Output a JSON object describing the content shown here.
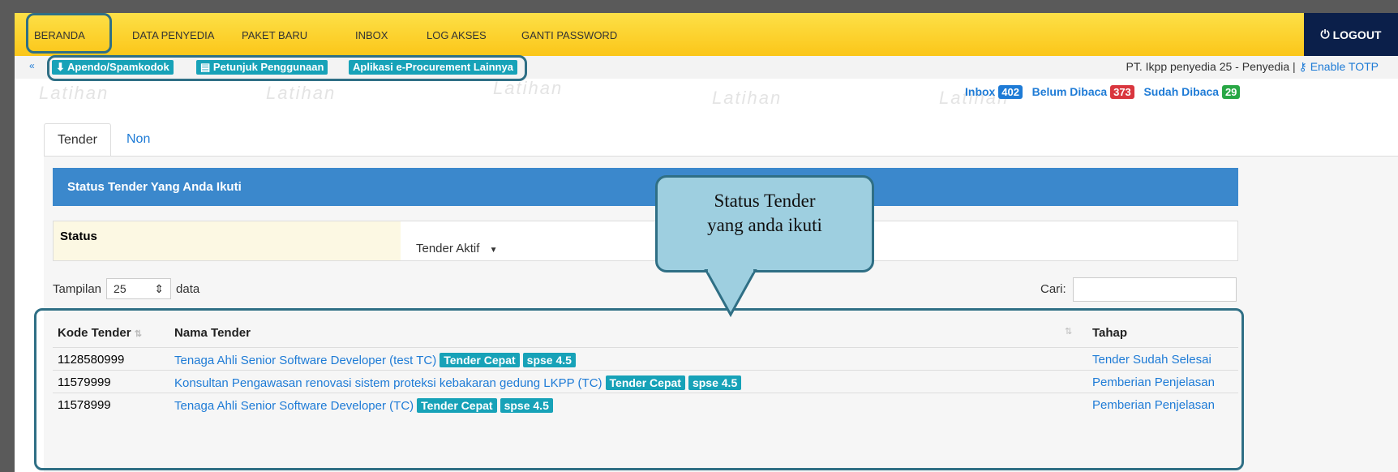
{
  "nav": {
    "items": [
      "BERANDA",
      "DATA PENYEDIA",
      "PAKET BARU",
      "INBOX",
      "LOG AKSES",
      "GANTI PASSWORD"
    ],
    "logout_label": "LOGOUT"
  },
  "toolbar": {
    "apendo_label": "Apendo/Spamkodok",
    "petunjuk_label": "Petunjuk Penggunaan",
    "eproc_label": "Aplikasi e-Procurement Lainnya"
  },
  "user": {
    "name_text": "PT. Ikpp penyedia 25 - Penyedia |",
    "totp_label": "Enable TOTP"
  },
  "inbox": {
    "inbox_label": "Inbox",
    "inbox_count": "402",
    "unread_label": "Belum Dibaca",
    "unread_count": "373",
    "read_label": "Sudah Dibaca",
    "read_count": "29"
  },
  "watermark_text": "Latihan",
  "tabs": [
    "Tender",
    "Non Tender"
  ],
  "panel": {
    "title": "Status Tender Yang Anda Ikuti",
    "status_label": "Status",
    "status_value": "Tender Aktif"
  },
  "table_controls": {
    "show_label": "Tampilan",
    "show_value": "25",
    "data_label": "data",
    "search_label": "Cari:"
  },
  "table": {
    "headers": [
      "Kode Tender",
      "Nama Tender",
      "Tahap"
    ],
    "rows": [
      {
        "kode": "1128580999",
        "nama": "Tenaga Ahli Senior Software Developer (test TC)",
        "tag1": "Tender Cepat",
        "tag2": "spse 4.5",
        "tahap": "Tender Sudah Selesai"
      },
      {
        "kode": "11579999",
        "nama": "Konsultan Pengawasan renovasi sistem proteksi kebakaran gedung LKPP (TC)",
        "tag1": "Tender Cepat",
        "tag2": "spse 4.5",
        "tahap": "Pemberian Penjelasan"
      },
      {
        "kode": "11578999",
        "nama": "Tenaga Ahli Senior Software Developer (TC)",
        "tag1": "Tender Cepat",
        "tag2": "spse 4.5",
        "tahap": "Pemberian Penjelasan"
      }
    ]
  },
  "callout": {
    "line1": "Status Tender",
    "line2": "yang anda ikuti"
  },
  "colors": {
    "accent": "#1e7bd6",
    "topbar": "#fcd12a",
    "teal": "#17a2b8",
    "panel": "#3b88cc",
    "logout_bg": "#0b1f4a",
    "highlight": "#2f6f85"
  }
}
